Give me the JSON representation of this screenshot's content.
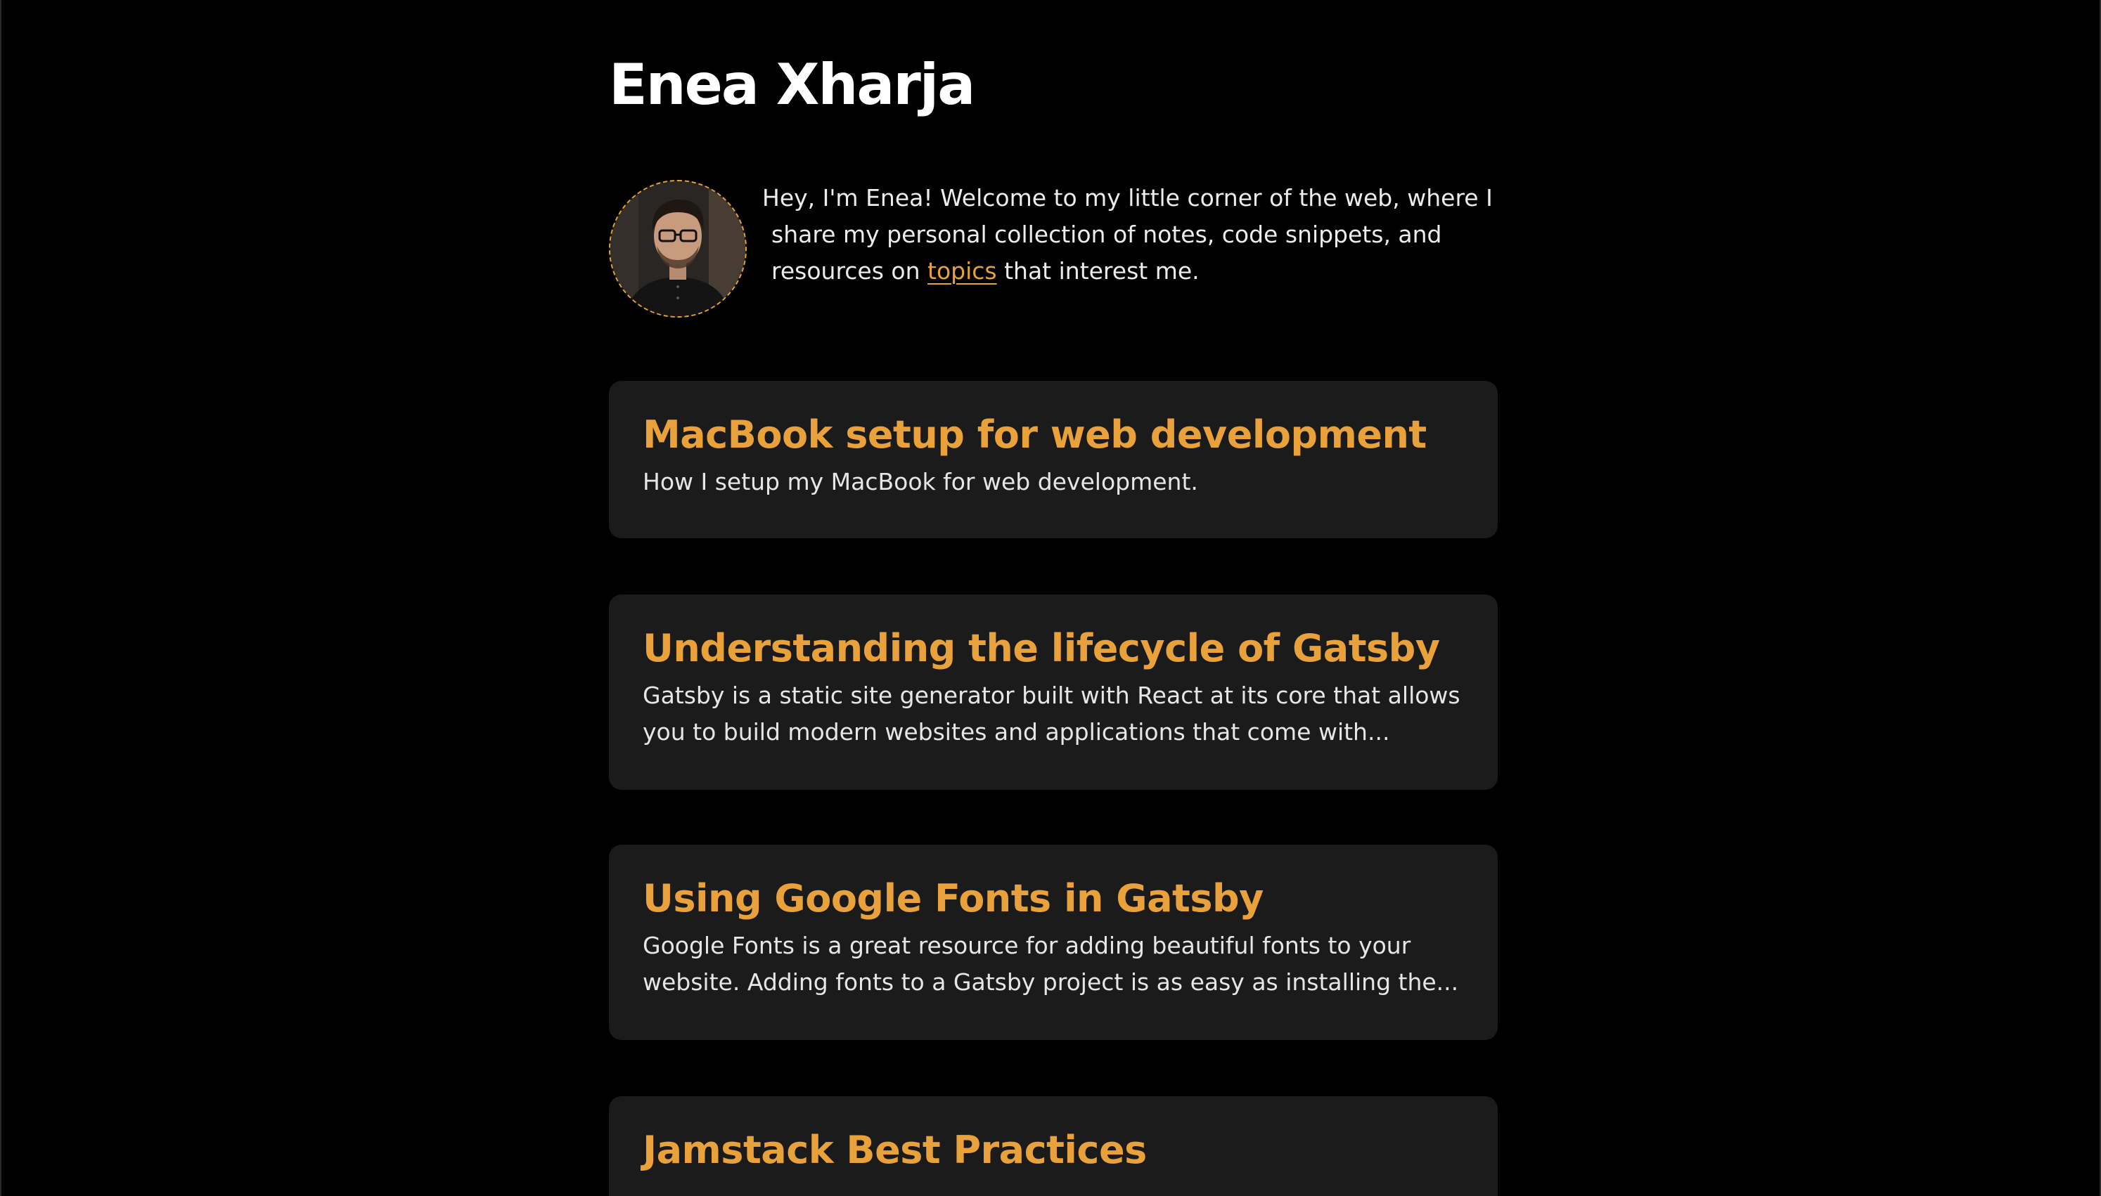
{
  "site": {
    "title": "Enea Xharja"
  },
  "intro": {
    "line1": "Hey, I'm Enea! Welcome to my little corner of the web, where I",
    "line2": "share my personal collection of notes, code snippets, and",
    "line3_before": "resources on ",
    "link_label": "topics",
    "line3_after": " that interest me."
  },
  "avatar": {
    "icon": "profile-photo",
    "border_color": "#e9a23b"
  },
  "posts": [
    {
      "title": "MacBook setup for web development",
      "desc_lines": [
        "How I setup my MacBook for web development."
      ]
    },
    {
      "title": "Understanding the lifecycle of Gatsby",
      "desc_lines": [
        "Gatsby is a static site generator built with React at its core that allows",
        "you to build modern websites and applications that come with..."
      ]
    },
    {
      "title": "Using Google Fonts in Gatsby",
      "desc_lines": [
        "Google Fonts is a great resource for adding beautiful fonts to your",
        "website. Adding fonts to a Gatsby project is as easy as installing the..."
      ]
    },
    {
      "title": "Jamstack Best Practices",
      "desc_lines": []
    }
  ],
  "colors": {
    "background": "#000000",
    "card": "#1b1b1b",
    "accent": "#e9a23b",
    "text": "#e9e9e9"
  }
}
